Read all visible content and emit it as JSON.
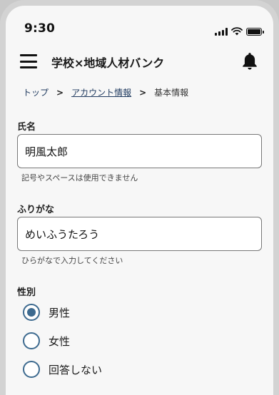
{
  "status_bar": {
    "time": "9:30"
  },
  "app_bar": {
    "title": "学校×地域人材バンク"
  },
  "breadcrumb": {
    "items": [
      {
        "label": "トップ"
      },
      {
        "label": "アカウント情報"
      },
      {
        "label": "基本情報"
      }
    ],
    "separator": ">"
  },
  "form": {
    "name": {
      "label": "氏名",
      "value": "明風太郎",
      "hint": "記号やスペースは使用できません"
    },
    "furigana": {
      "label": "ふりがな",
      "value": "めいふうたろう",
      "hint": "ひらがなで入力してください"
    },
    "gender": {
      "label": "性別",
      "options": [
        {
          "label": "男性",
          "selected": true
        },
        {
          "label": "女性",
          "selected": false
        },
        {
          "label": "回答しない",
          "selected": false
        }
      ]
    }
  },
  "colors": {
    "accent": "#3d6a8f",
    "link": "#1f3a5f",
    "background": "#f7f7f7"
  },
  "icons": {
    "menu": "hamburger-menu-icon",
    "notifications": "bell-icon"
  }
}
